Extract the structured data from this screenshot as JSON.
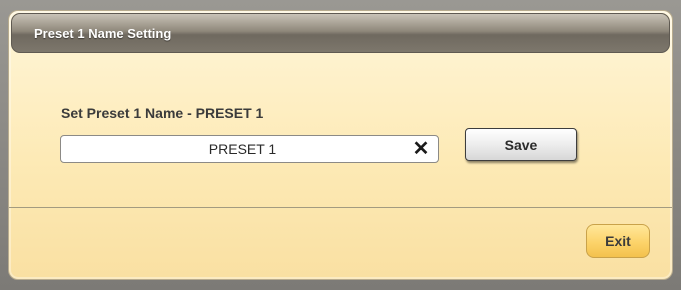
{
  "dialog": {
    "title": "Preset 1 Name Setting",
    "field_label": "Set Preset 1 Name - PRESET 1",
    "name_input": {
      "value": "PRESET 1",
      "placeholder": ""
    },
    "clear_icon": "✕",
    "save_label": "Save",
    "exit_label": "Exit"
  },
  "icons": {
    "clear": "close-icon"
  },
  "colors": {
    "dialog_background": "#fdeab6",
    "titlebar": "#8f887b",
    "exit_button": "#fcd36a"
  }
}
